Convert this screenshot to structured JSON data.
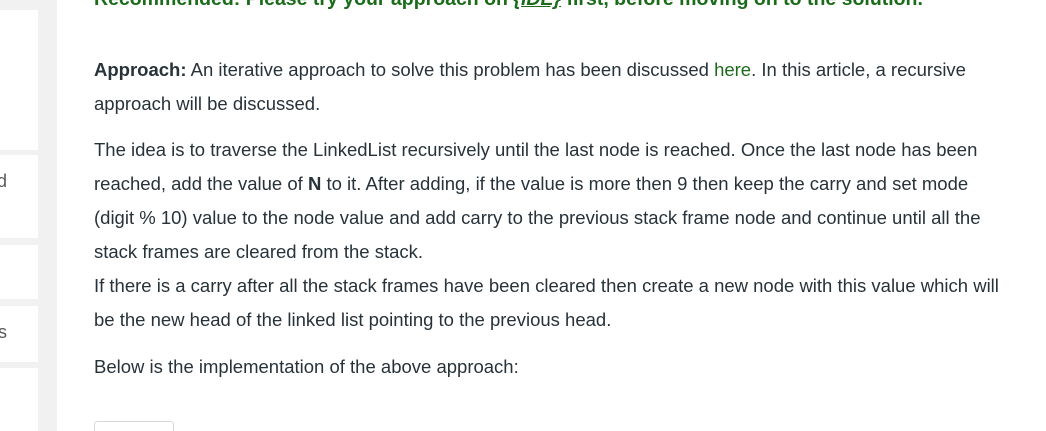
{
  "sidebar": {
    "cards": [
      {
        "text": ""
      },
      {
        "text": "d"
      },
      {
        "text": ""
      },
      {
        "text": "s"
      },
      {
        "text": ""
      }
    ]
  },
  "article": {
    "recommended": {
      "prefix": "Recommended: Please try your approach on ",
      "ide": "{IDE}",
      "suffix": " first, before moving on to the solution."
    },
    "approach": {
      "label": "Approach:",
      "text_before": " An iterative approach to solve this problem has been discussed ",
      "link": "here",
      "text_after": ". In this article, a recursive approach will be discussed."
    },
    "idea": {
      "part1": "The idea is to traverse the LinkedList recursively until the last node is reached. Once the last node has been reached, add the value of ",
      "bold": "N",
      "part2": " to it. After adding, if the value is more then 9 then keep the carry and set mode (digit % 10) value to the node value and add carry to the previous stack frame node and continue until all the stack frames are cleared from the stack.",
      "part3": "If there is a carry after all the stack frames have been cleared then create a new node with this value which will be the new head of the linked list pointing to the previous head."
    },
    "below": "Below is the implementation of the above approach:"
  }
}
